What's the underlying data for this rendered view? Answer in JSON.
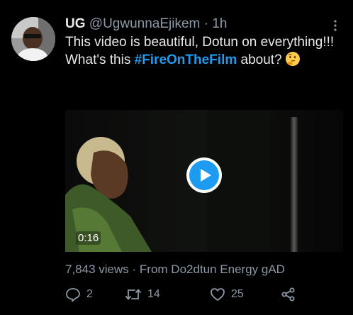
{
  "tweet": {
    "display_name": "UG",
    "handle": "@UgwunnaEjikem",
    "separator": "·",
    "time": "1h",
    "text_part1": "This video is beautiful, Dotun on everything!!! What's this ",
    "hashtag": "#FireOnTheFilm",
    "text_part2": " about?",
    "emoji": "thinking-face",
    "video": {
      "duration": "0:16"
    },
    "views": "7,843 views",
    "meta_separator": "·",
    "source": "From Do2dtun Energy gAD",
    "counts": {
      "replies": "2",
      "retweets": "14",
      "likes": "25"
    }
  },
  "icons": {
    "more": "more-vertical-icon",
    "reply": "reply-icon",
    "retweet": "retweet-icon",
    "like": "heart-icon",
    "share": "share-icon",
    "play": "play-icon"
  },
  "colors": {
    "background": "#000000",
    "text": "#e7e9ea",
    "muted": "#8b98a5",
    "accent": "#1d9bf0"
  }
}
